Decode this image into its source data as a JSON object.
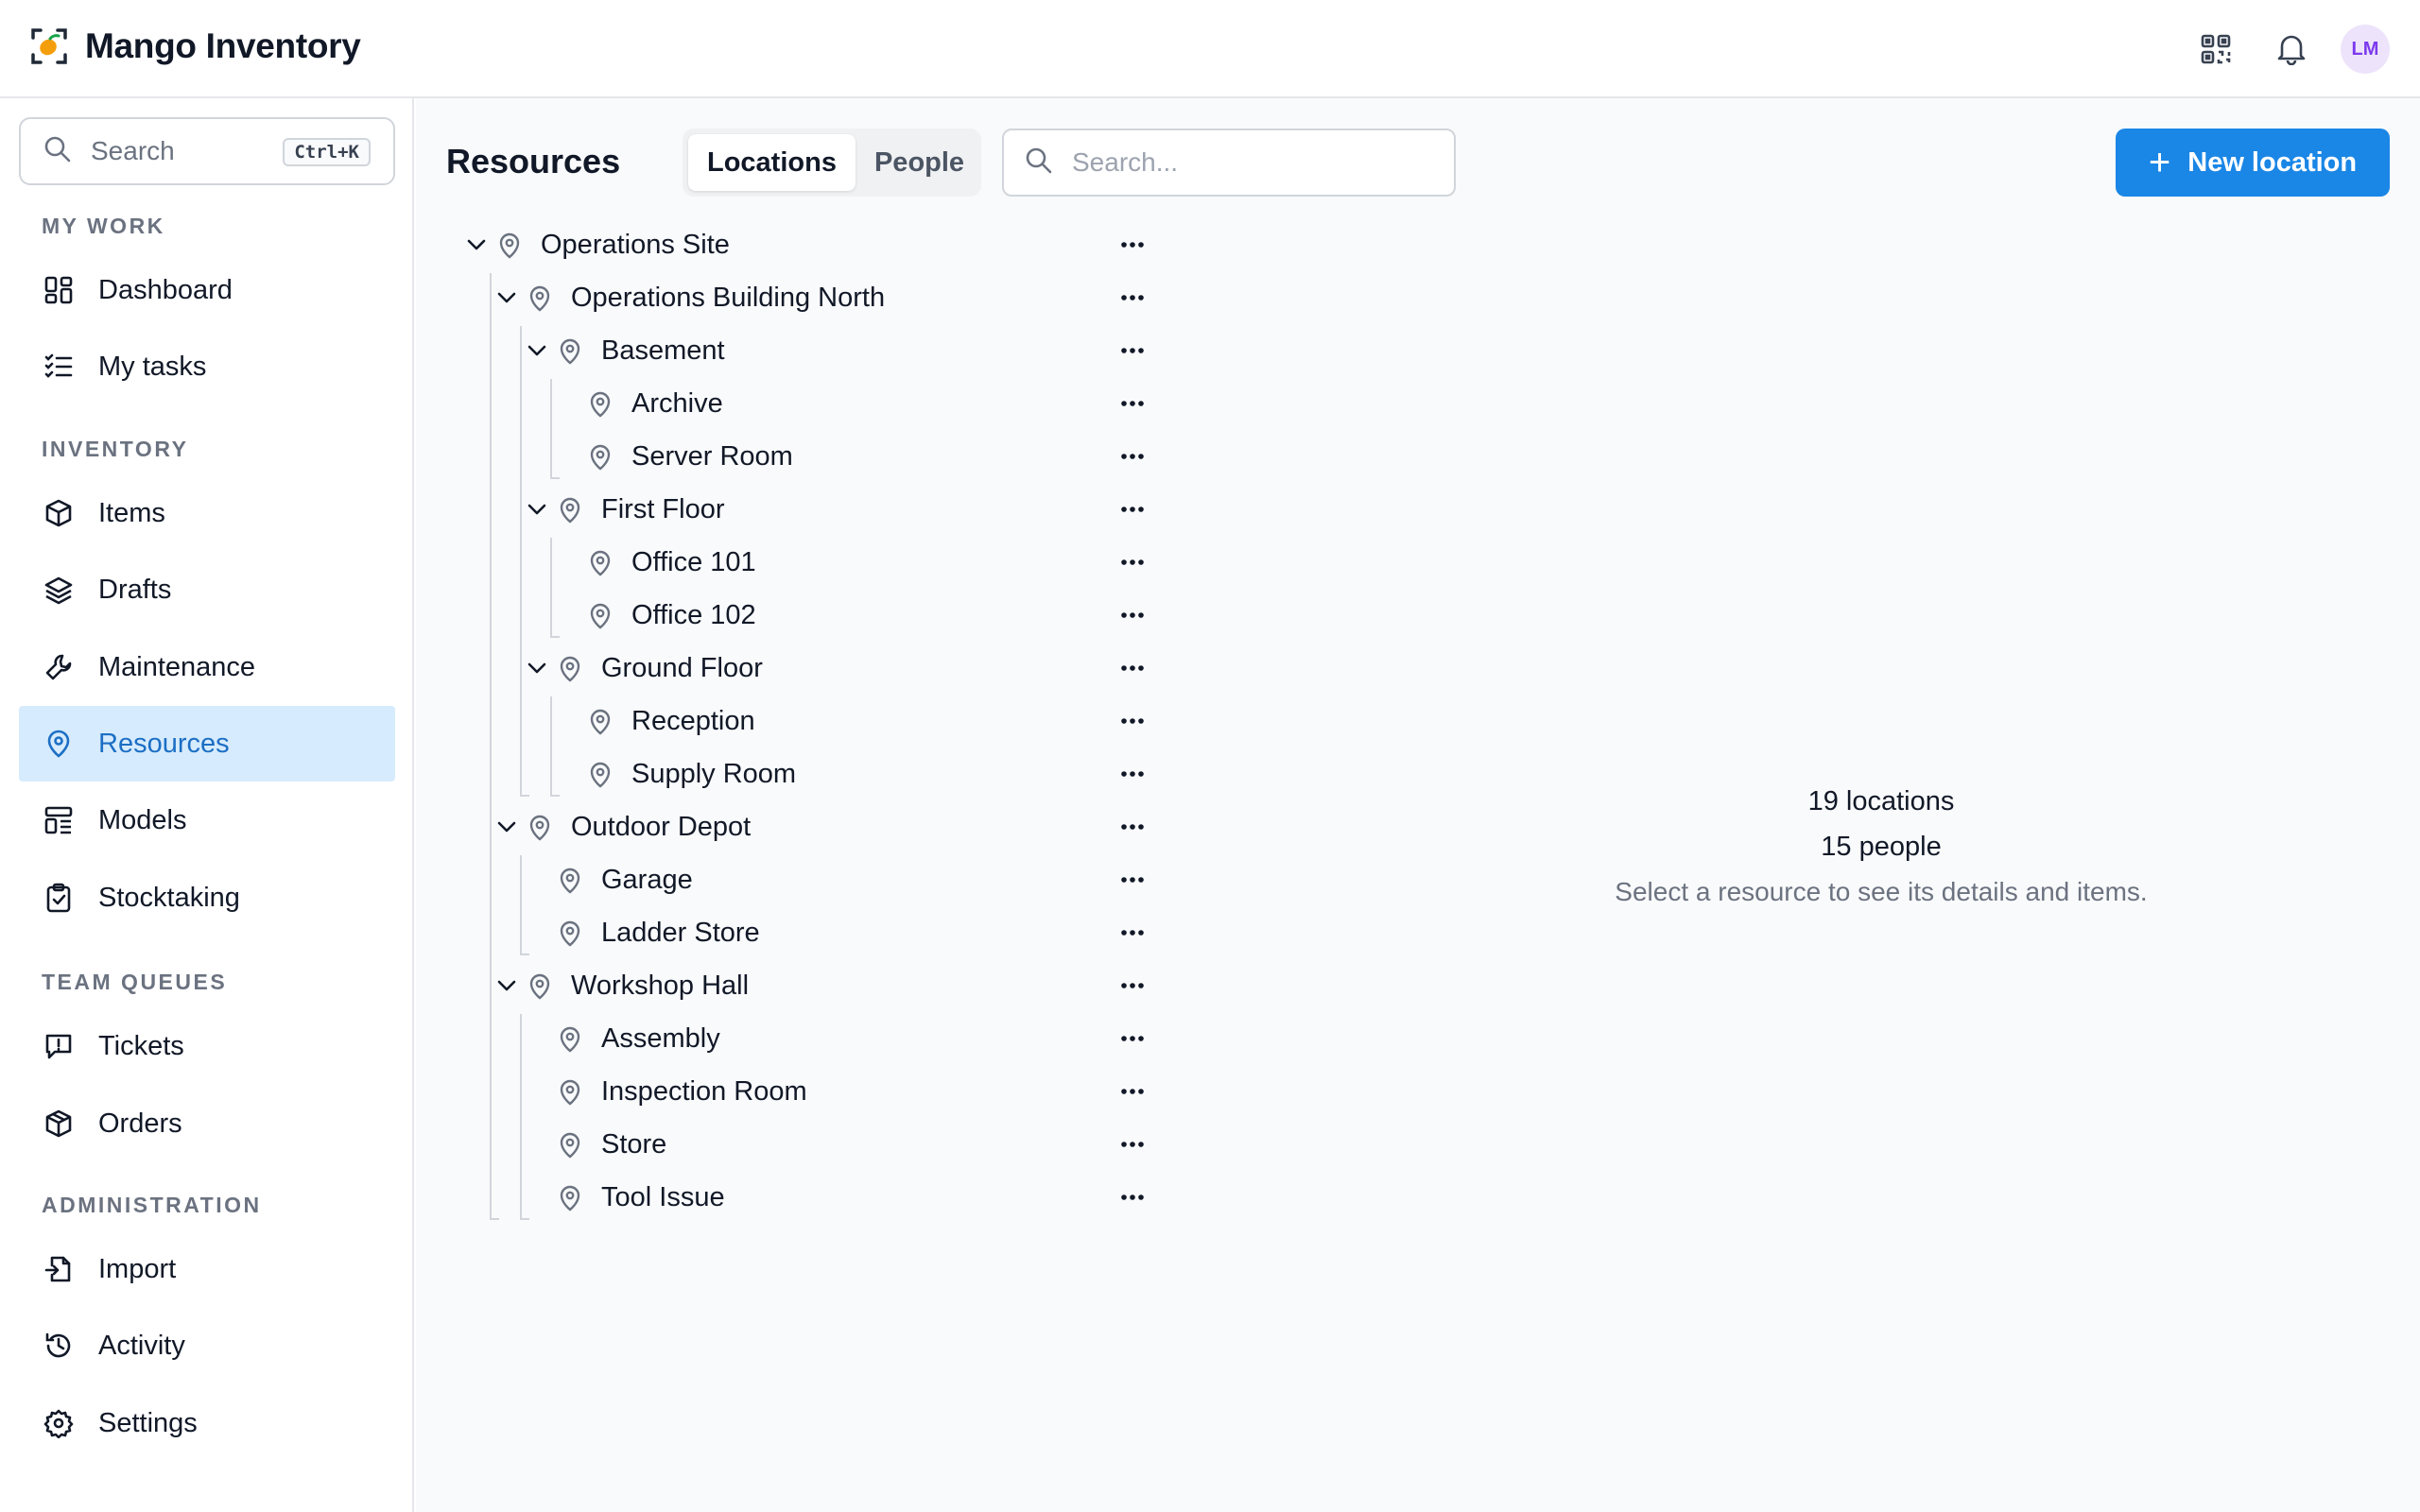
{
  "app": {
    "name": "Mango Inventory",
    "avatar_initials": "LM",
    "accent": "#1a86e6"
  },
  "header": {
    "icons": [
      "qr-code-icon",
      "bell-icon"
    ]
  },
  "sidebar": {
    "search": {
      "label": "Search",
      "shortcut": "Ctrl+K"
    },
    "sections": {
      "my_work": "MY WORK",
      "inventory": "INVENTORY",
      "team_queues": "TEAM QUEUES",
      "administration": "ADMINISTRATION"
    },
    "items": {
      "dashboard": "Dashboard",
      "my_tasks": "My tasks",
      "items": "Items",
      "drafts": "Drafts",
      "maintenance": "Maintenance",
      "resources": "Resources",
      "models": "Models",
      "stocktaking": "Stocktaking",
      "tickets": "Tickets",
      "orders": "Orders",
      "import": "Import",
      "activity": "Activity",
      "settings": "Settings"
    },
    "active": "resources"
  },
  "main": {
    "title": "Resources",
    "tabs": [
      {
        "label": "Locations",
        "active": true
      },
      {
        "label": "People",
        "active": false
      }
    ],
    "search_placeholder": "Search...",
    "new_button": "New location",
    "tree": [
      {
        "label": "Operations Site",
        "level": 0,
        "expandable": true
      },
      {
        "label": "Operations Building North",
        "level": 1,
        "expandable": true
      },
      {
        "label": "Basement",
        "level": 2,
        "expandable": true
      },
      {
        "label": "Archive",
        "level": 3,
        "expandable": false
      },
      {
        "label": "Server Room",
        "level": 3,
        "expandable": false
      },
      {
        "label": "First Floor",
        "level": 2,
        "expandable": true
      },
      {
        "label": "Office 101",
        "level": 3,
        "expandable": false
      },
      {
        "label": "Office 102",
        "level": 3,
        "expandable": false
      },
      {
        "label": "Ground Floor",
        "level": 2,
        "expandable": true
      },
      {
        "label": "Reception",
        "level": 3,
        "expandable": false
      },
      {
        "label": "Supply Room",
        "level": 3,
        "expandable": false
      },
      {
        "label": "Outdoor Depot",
        "level": 1,
        "expandable": true
      },
      {
        "label": "Garage",
        "level": 2,
        "expandable": false
      },
      {
        "label": "Ladder Store",
        "level": 2,
        "expandable": false
      },
      {
        "label": "Workshop Hall",
        "level": 1,
        "expandable": true
      },
      {
        "label": "Assembly",
        "level": 2,
        "expandable": false
      },
      {
        "label": "Inspection Room",
        "level": 2,
        "expandable": false
      },
      {
        "label": "Store",
        "level": 2,
        "expandable": false
      },
      {
        "label": "Tool Issue",
        "level": 2,
        "expandable": false
      }
    ],
    "summary": {
      "locations": "19 locations",
      "people": "15 people",
      "hint": "Select a resource to see its details and items."
    }
  }
}
